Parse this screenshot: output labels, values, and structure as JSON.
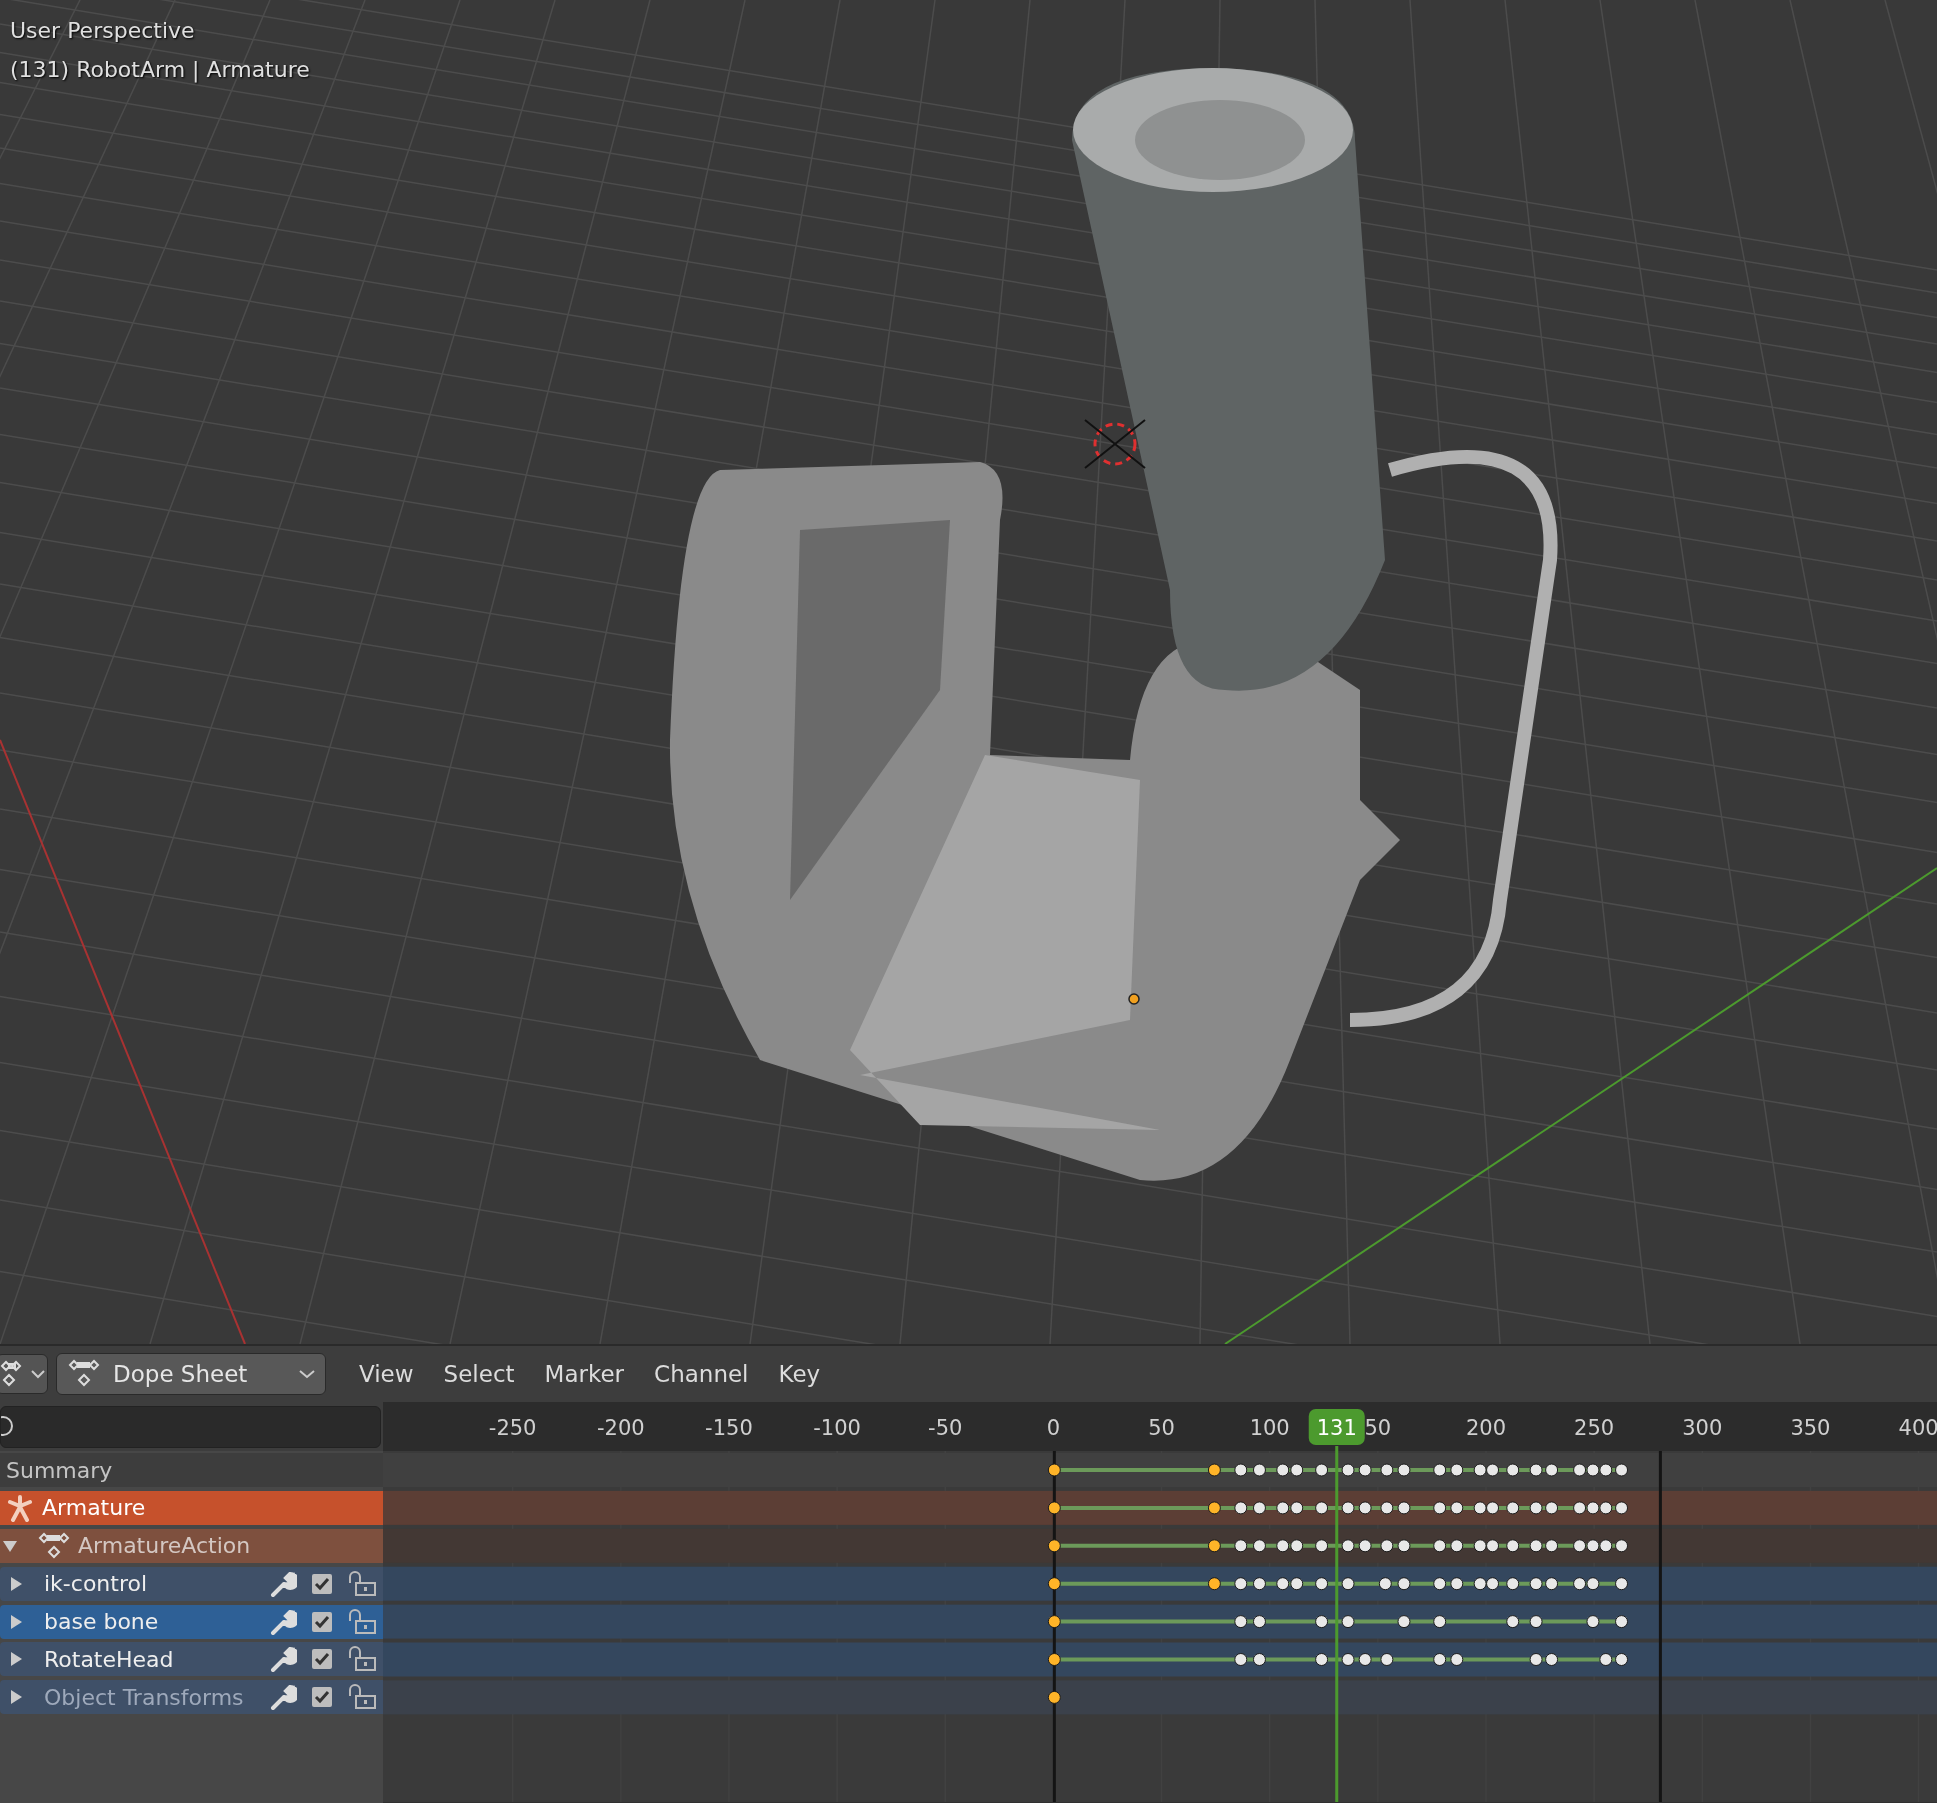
{
  "viewport": {
    "view_name": "User Perspective",
    "object_info": "(131) RobotArm | Armature"
  },
  "header": {
    "editor_menu": "Dope Sheet",
    "menus": [
      "View",
      "Select",
      "Marker",
      "Channel",
      "Key"
    ]
  },
  "timeline": {
    "ruler_labels": [
      "-250",
      "-200",
      "-150",
      "-100",
      "-50",
      "0",
      "50",
      "100",
      "50",
      "200",
      "250",
      "300",
      "350",
      "400"
    ],
    "current_frame": "131",
    "range_lines": [
      {
        "level": 0.432
      },
      {
        "level": 0.822
      }
    ],
    "channels": [
      {
        "kind": "summary",
        "name": "Summary",
        "keys": [
          {
            "level": 0.432,
            "selected": true
          },
          {
            "level": 0.535,
            "selected": true
          },
          {
            "level": 0.552,
            "selected": false
          },
          {
            "level": 0.564,
            "selected": false
          },
          {
            "level": 0.579,
            "selected": false
          },
          {
            "level": 0.588,
            "selected": false
          },
          {
            "level": 0.604,
            "selected": false
          },
          {
            "level": 0.621,
            "selected": false
          },
          {
            "level": 0.632,
            "selected": false
          },
          {
            "level": 0.646,
            "selected": false
          },
          {
            "level": 0.657,
            "selected": false
          },
          {
            "level": 0.68,
            "selected": false
          },
          {
            "level": 0.691,
            "selected": false
          },
          {
            "level": 0.706,
            "selected": false
          },
          {
            "level": 0.714,
            "selected": false
          },
          {
            "level": 0.727,
            "selected": false
          },
          {
            "level": 0.742,
            "selected": false
          },
          {
            "level": 0.752,
            "selected": false
          },
          {
            "level": 0.77,
            "selected": false
          },
          {
            "level": 0.7786,
            "selected": false
          },
          {
            "level": 0.7869,
            "selected": false
          },
          {
            "level": 0.797,
            "selected": false
          }
        ]
      },
      {
        "kind": "object",
        "name": "Armature",
        "keys": [
          {
            "level": 0.432,
            "selected": true
          },
          {
            "level": 0.535,
            "selected": true
          },
          {
            "level": 0.552,
            "selected": false
          },
          {
            "level": 0.564,
            "selected": false
          },
          {
            "level": 0.579,
            "selected": false
          },
          {
            "level": 0.588,
            "selected": false
          },
          {
            "level": 0.604,
            "selected": false
          },
          {
            "level": 0.621,
            "selected": false
          },
          {
            "level": 0.632,
            "selected": false
          },
          {
            "level": 0.646,
            "selected": false
          },
          {
            "level": 0.657,
            "selected": false
          },
          {
            "level": 0.68,
            "selected": false
          },
          {
            "level": 0.691,
            "selected": false
          },
          {
            "level": 0.706,
            "selected": false
          },
          {
            "level": 0.714,
            "selected": false
          },
          {
            "level": 0.727,
            "selected": false
          },
          {
            "level": 0.742,
            "selected": false
          },
          {
            "level": 0.752,
            "selected": false
          },
          {
            "level": 0.77,
            "selected": false
          },
          {
            "level": 0.7786,
            "selected": false
          },
          {
            "level": 0.7869,
            "selected": false
          },
          {
            "level": 0.797,
            "selected": false
          }
        ]
      },
      {
        "kind": "action",
        "name": "ArmatureAction",
        "expanded": true,
        "keys": [
          {
            "level": 0.432,
            "selected": true
          },
          {
            "level": 0.535,
            "selected": true
          },
          {
            "level": 0.552,
            "selected": false
          },
          {
            "level": 0.564,
            "selected": false
          },
          {
            "level": 0.579,
            "selected": false
          },
          {
            "level": 0.588,
            "selected": false
          },
          {
            "level": 0.604,
            "selected": false
          },
          {
            "level": 0.621,
            "selected": false
          },
          {
            "level": 0.632,
            "selected": false
          },
          {
            "level": 0.646,
            "selected": false
          },
          {
            "level": 0.657,
            "selected": false
          },
          {
            "level": 0.68,
            "selected": false
          },
          {
            "level": 0.691,
            "selected": false
          },
          {
            "level": 0.706,
            "selected": false
          },
          {
            "level": 0.714,
            "selected": false
          },
          {
            "level": 0.727,
            "selected": false
          },
          {
            "level": 0.742,
            "selected": false
          },
          {
            "level": 0.752,
            "selected": false
          },
          {
            "level": 0.77,
            "selected": false
          },
          {
            "level": 0.7786,
            "selected": false
          },
          {
            "level": 0.7869,
            "selected": false
          },
          {
            "level": 0.797,
            "selected": false
          }
        ]
      },
      {
        "kind": "group",
        "name": "ik-control",
        "selected": false,
        "expanded": false,
        "disabled": false,
        "checked": true,
        "locked": false,
        "keys": [
          {
            "level": 0.432,
            "selected": true
          },
          {
            "level": 0.535,
            "selected": true
          },
          {
            "level": 0.552,
            "selected": false
          },
          {
            "level": 0.564,
            "selected": false
          },
          {
            "level": 0.579,
            "selected": false
          },
          {
            "level": 0.588,
            "selected": false
          },
          {
            "level": 0.604,
            "selected": false
          },
          {
            "level": 0.621,
            "selected": false
          },
          {
            "level": 0.645,
            "selected": false
          },
          {
            "level": 0.657,
            "selected": false
          },
          {
            "level": 0.68,
            "selected": false
          },
          {
            "level": 0.691,
            "selected": false
          },
          {
            "level": 0.706,
            "selected": false
          },
          {
            "level": 0.714,
            "selected": false
          },
          {
            "level": 0.727,
            "selected": false
          },
          {
            "level": 0.742,
            "selected": false
          },
          {
            "level": 0.752,
            "selected": false
          },
          {
            "level": 0.77,
            "selected": false
          },
          {
            "level": 0.7786,
            "selected": false
          },
          {
            "level": 0.797,
            "selected": false
          }
        ]
      },
      {
        "kind": "group",
        "name": "base bone",
        "selected": true,
        "expanded": false,
        "disabled": false,
        "checked": true,
        "locked": false,
        "keys": [
          {
            "level": 0.432,
            "selected": true
          },
          {
            "level": 0.552,
            "selected": false
          },
          {
            "level": 0.564,
            "selected": false
          },
          {
            "level": 0.604,
            "selected": false
          },
          {
            "level": 0.621,
            "selected": false
          },
          {
            "level": 0.657,
            "selected": false
          },
          {
            "level": 0.68,
            "selected": false
          },
          {
            "level": 0.727,
            "selected": false
          },
          {
            "level": 0.742,
            "selected": false
          },
          {
            "level": 0.7786,
            "selected": false
          },
          {
            "level": 0.797,
            "selected": false
          }
        ]
      },
      {
        "kind": "group",
        "name": "RotateHead",
        "selected": false,
        "expanded": false,
        "disabled": false,
        "checked": true,
        "locked": false,
        "keys": [
          {
            "level": 0.432,
            "selected": true
          },
          {
            "level": 0.552,
            "selected": false
          },
          {
            "level": 0.564,
            "selected": false
          },
          {
            "level": 0.604,
            "selected": false
          },
          {
            "level": 0.621,
            "selected": false
          },
          {
            "level": 0.632,
            "selected": false
          },
          {
            "level": 0.646,
            "selected": false
          },
          {
            "level": 0.68,
            "selected": false
          },
          {
            "level": 0.691,
            "selected": false
          },
          {
            "level": 0.742,
            "selected": false
          },
          {
            "level": 0.752,
            "selected": false
          },
          {
            "level": 0.7869,
            "selected": false
          },
          {
            "level": 0.797,
            "selected": false
          }
        ]
      },
      {
        "kind": "group",
        "name": "Object Transforms",
        "selected": false,
        "expanded": false,
        "disabled": true,
        "checked": true,
        "locked": false,
        "keys": [
          {
            "level": 0.432,
            "selected": true
          }
        ]
      }
    ]
  }
}
